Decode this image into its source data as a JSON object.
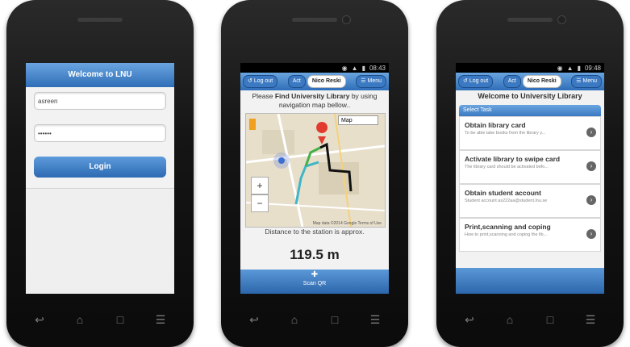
{
  "login_screen": {
    "title": "Welcome to LNU",
    "username_value": "asreen",
    "password_value": "••••••",
    "login_label": "Login"
  },
  "map_screen": {
    "status_time": "08:43",
    "logout_label": "Log out",
    "tab_act": "Act",
    "tab_user": "Nico Reski",
    "menu_label": "Menu",
    "instruction_pre": "Please ",
    "instruction_bold": "Find University Library",
    "instruction_post": " by using navigation map bellow..",
    "map_type": "Map",
    "zoom_in": "+",
    "zoom_out": "−",
    "map_footer": "Map data ©2014 Google   Terms of Use",
    "distance_text": "Distance to the station is approx.",
    "distance_value": "119.5 m",
    "scan_label": "Scan QR"
  },
  "task_screen": {
    "status_time": "09:48",
    "logout_label": "Log out",
    "tab_act": "Act",
    "tab_user": "Nico Reski",
    "menu_label": "Menu",
    "heading": "Welcome to University Library",
    "task_header": "Select Task",
    "tasks": [
      {
        "title": "Obtain library card",
        "subtitle": "To be able take books from the library y..."
      },
      {
        "title": "Activate library to swipe card",
        "subtitle": "The library card should be activated befo..."
      },
      {
        "title": "Obtain student account",
        "subtitle": "Student account as222aa@student.lnu.se"
      },
      {
        "title": "Print,scanning and coping",
        "subtitle": "How to print,scanning and coping the lib..."
      }
    ]
  },
  "softkeys": [
    "↩",
    "⌂",
    "□",
    "☰"
  ]
}
